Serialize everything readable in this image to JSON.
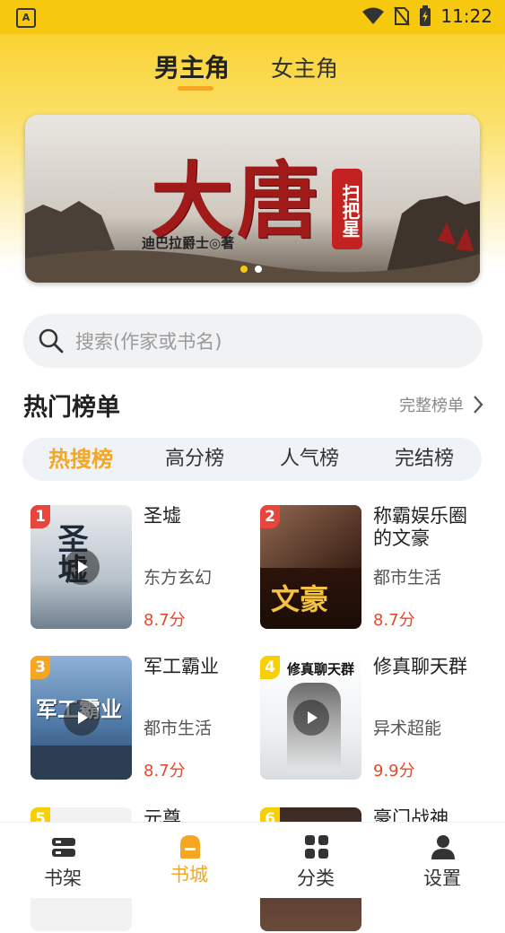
{
  "status_bar": {
    "time": "11:22"
  },
  "gender_tabs": [
    {
      "label": "男主角",
      "active": true
    },
    {
      "label": "女主角",
      "active": false
    }
  ],
  "banner": {
    "title": "大唐",
    "seal_text": "扫把星",
    "author": "迪巴拉爵士◎著",
    "page_count": 2,
    "current_page": 1
  },
  "search": {
    "placeholder": "搜索(作家或书名)"
  },
  "section": {
    "title": "热门榜单",
    "more_label": "完整榜单"
  },
  "rank_tabs": [
    {
      "label": "热搜榜",
      "active": true
    },
    {
      "label": "高分榜",
      "active": false
    },
    {
      "label": "人气榜",
      "active": false
    },
    {
      "label": "完结榜",
      "active": false
    }
  ],
  "books": [
    {
      "rank": "1",
      "title": "圣墟",
      "category": "东方玄幻",
      "score": "8.7分",
      "cover_text": "圣墟"
    },
    {
      "rank": "2",
      "title": "称霸娱乐圈的文豪",
      "category": "都市生活",
      "score": "8.7分",
      "cover_text": "文豪"
    },
    {
      "rank": "3",
      "title": "军工霸业",
      "category": "都市生活",
      "score": "8.7分",
      "cover_text": "军工霸业"
    },
    {
      "rank": "4",
      "title": "修真聊天群",
      "category": "异术超能",
      "score": "9.9分",
      "cover_text": "修真聊天群"
    },
    {
      "rank": "5",
      "title": "元尊",
      "category": "",
      "score": "",
      "cover_text": ""
    },
    {
      "rank": "6",
      "title": "豪门战神",
      "category": "",
      "score": "",
      "cover_text": ""
    }
  ],
  "bottom_nav": [
    {
      "label": "书架",
      "icon": "bookshelf-icon",
      "active": false
    },
    {
      "label": "书城",
      "icon": "store-icon",
      "active": true
    },
    {
      "label": "分类",
      "icon": "category-icon",
      "active": false
    },
    {
      "label": "设置",
      "icon": "user-icon",
      "active": false
    }
  ],
  "colors": {
    "accent": "#f5a623",
    "header_yellow": "#f6c90e",
    "score_red": "#e24a2a",
    "rank_red": "#e8453c"
  }
}
